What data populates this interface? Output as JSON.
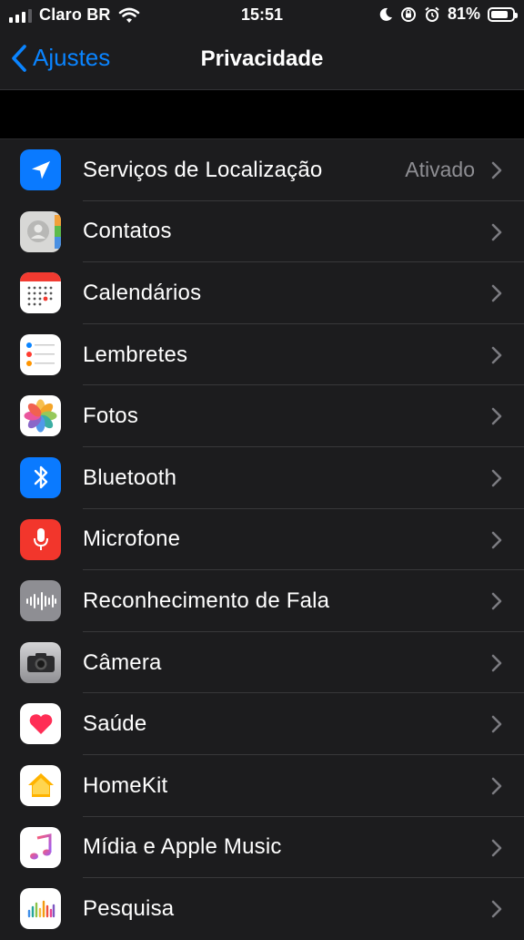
{
  "status": {
    "carrier": "Claro BR",
    "time": "15:51",
    "battery": "81%",
    "battery_level": 0.81
  },
  "nav": {
    "back_label": "Ajustes",
    "title": "Privacidade"
  },
  "items": [
    {
      "label": "Serviços de Localização",
      "value": "Ativado",
      "icon": "location-arrow-icon"
    },
    {
      "label": "Contatos",
      "value": "",
      "icon": "contacts-icon"
    },
    {
      "label": "Calendários",
      "value": "",
      "icon": "calendar-icon"
    },
    {
      "label": "Lembretes",
      "value": "",
      "icon": "reminders-icon"
    },
    {
      "label": "Fotos",
      "value": "",
      "icon": "photos-icon"
    },
    {
      "label": "Bluetooth",
      "value": "",
      "icon": "bluetooth-icon"
    },
    {
      "label": "Microfone",
      "value": "",
      "icon": "microphone-icon"
    },
    {
      "label": "Reconhecimento de Fala",
      "value": "",
      "icon": "speech-waveform-icon"
    },
    {
      "label": "Câmera",
      "value": "",
      "icon": "camera-icon"
    },
    {
      "label": "Saúde",
      "value": "",
      "icon": "health-heart-icon"
    },
    {
      "label": "HomeKit",
      "value": "",
      "icon": "homekit-house-icon"
    },
    {
      "label": "Mídia e Apple Music",
      "value": "",
      "icon": "music-note-icon"
    },
    {
      "label": "Pesquisa",
      "value": "",
      "icon": "research-icon"
    }
  ],
  "colors": {
    "accent": "#0a84ff",
    "background": "#000000",
    "cell": "#1c1c1e",
    "secondary_text": "#8e8e93"
  }
}
